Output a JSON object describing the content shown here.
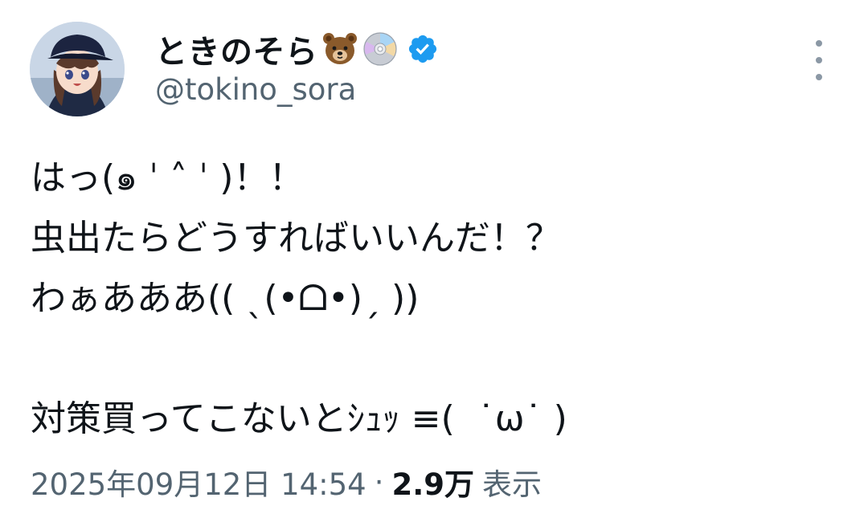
{
  "tweet": {
    "author": {
      "display_name": "ときのそら",
      "emoji_icons": [
        "bear-face-icon",
        "optical-disc-icon"
      ],
      "verified_icon": "verified-badge-icon",
      "handle": "@tokino_sora",
      "avatar": "avatar-image"
    },
    "menu_icon": "more-options-icon",
    "text": "はっ(๑ ˈ ˄ ˈ )！！\n虫出たらどうすればいいんだ！？\nわぁあああ(( ˎ(•ᗝ•)ˏ ))\n\n対策買ってこないとｼｭｯ ≡(  ˙ω˙ )",
    "timestamp": "2025年09月12日 14:54",
    "separator": "·",
    "views_count": "2.9万",
    "views_label": "表示"
  },
  "colors": {
    "text": "#0f1419",
    "secondary": "#536471",
    "verified": "#1d9bf0"
  }
}
